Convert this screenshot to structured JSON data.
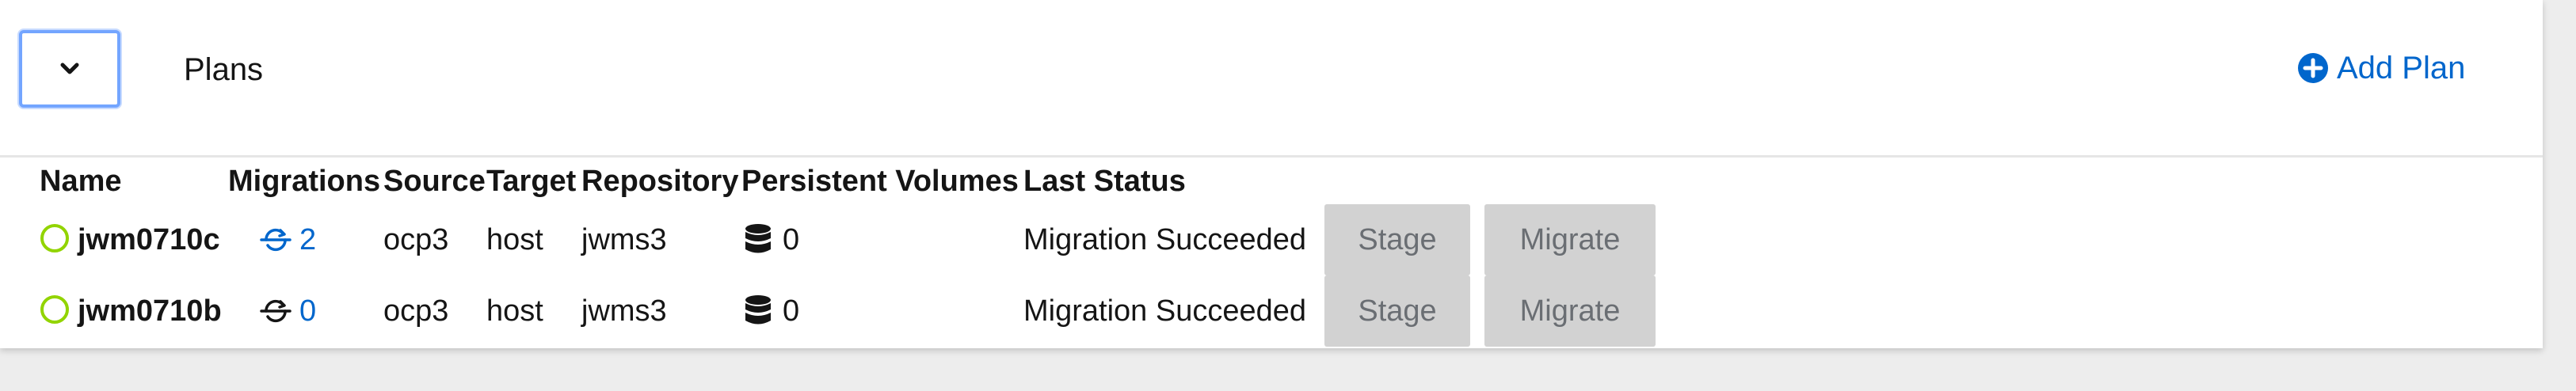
{
  "header": {
    "title": "Plans",
    "add_plan_label": "Add Plan"
  },
  "columns": [
    "Name",
    "Migrations",
    "Source",
    "Target",
    "Repository",
    "Persistent Volumes",
    "Last Status"
  ],
  "rows": [
    {
      "name": "jwm0710c",
      "migrations": "2",
      "source": "ocp3",
      "target": "host",
      "repository": "jwms3",
      "persistent_volumes": "0",
      "last_status": "Migration Succeeded",
      "stage_label": "Stage",
      "migrate_label": "Migrate"
    },
    {
      "name": "jwm0710b",
      "migrations": "0",
      "source": "ocp3",
      "target": "host",
      "repository": "jwms3",
      "persistent_volumes": "0",
      "last_status": "Migration Succeeded",
      "stage_label": "Stage",
      "migrate_label": "Migrate"
    }
  ],
  "icons": {
    "toggle": "chevron-down-icon",
    "add_plan": "plus-circle-icon",
    "status": "status-ring-icon",
    "migrations": "migration-sync-icon",
    "volumes": "database-icon"
  },
  "colors": {
    "accent": "#0066cc",
    "status_ok": "#92d400",
    "focus": "#73a5ff",
    "button_disabled_bg": "#d2d2d2",
    "button_disabled_text": "#6a6e73"
  }
}
